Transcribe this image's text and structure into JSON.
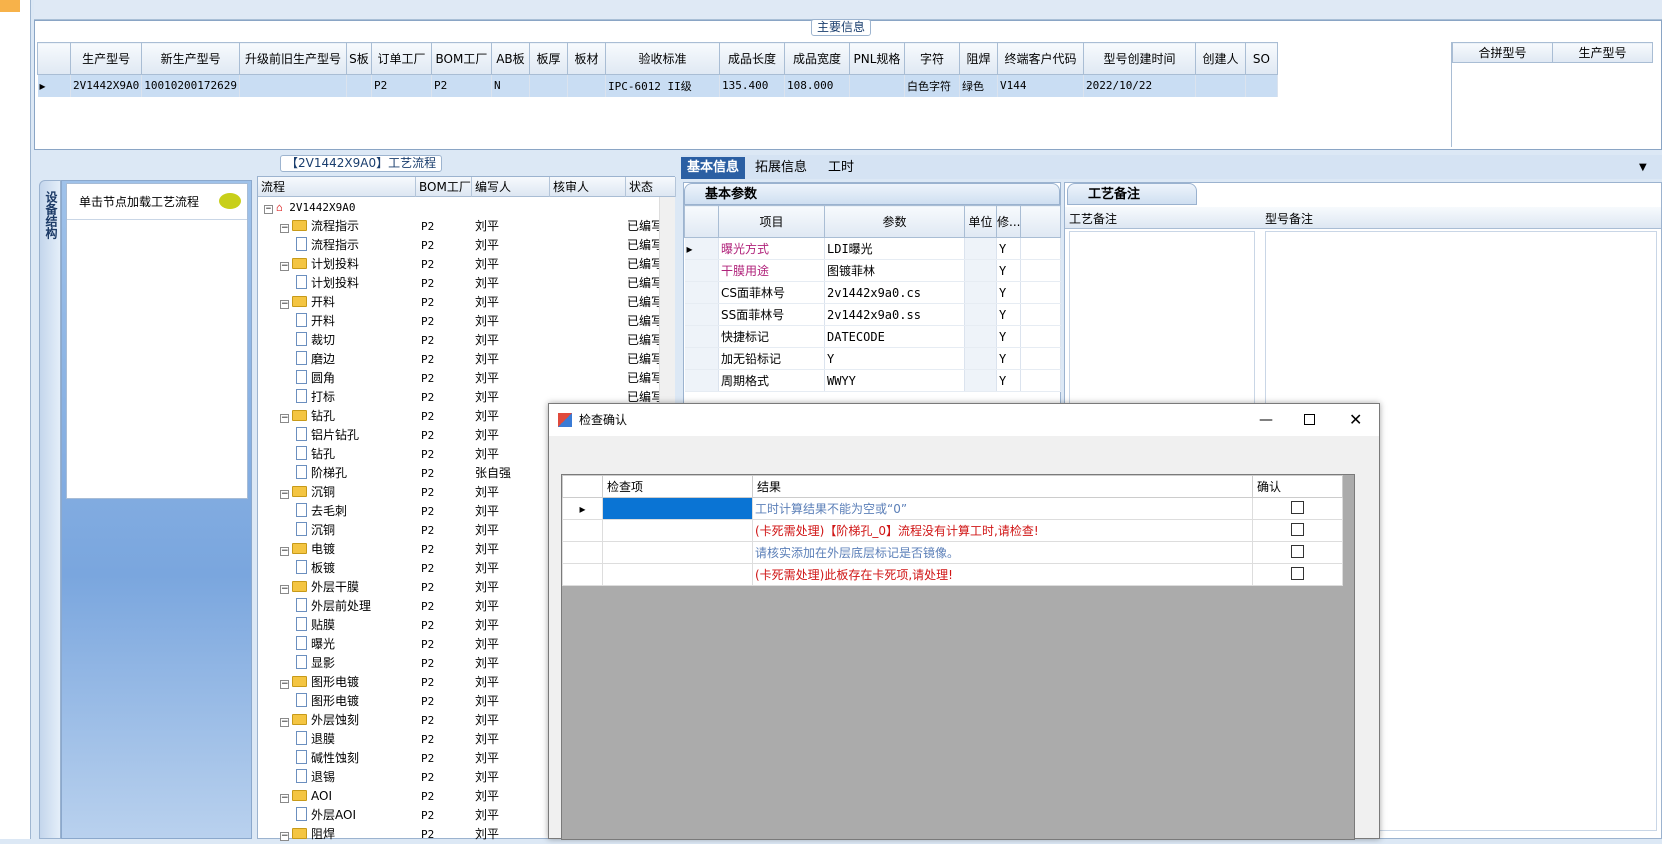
{
  "main_info": {
    "title": "主要信息",
    "columns": [
      "生产型号",
      "新生产型号",
      "升级前旧生产型号",
      "S板",
      "订单工厂",
      "BOM工厂",
      "AB板",
      "板厚",
      "板材",
      "验收标准",
      "成品长度",
      "成品宽度",
      "PNL规格",
      "字符",
      "阻焊",
      "终端客户代码",
      "型号创建时间",
      "创建人",
      "SO"
    ],
    "row": [
      "2V1442X9A0",
      "10010200172629",
      "",
      "",
      "P2",
      "P2",
      "N",
      "",
      "",
      "IPC-6012 II级",
      "135.400",
      "108.000",
      "",
      "白色字符",
      "绿色",
      "V144",
      "2022/10/22",
      "",
      ""
    ],
    "side_columns": [
      "合拼型号",
      "生产型号"
    ]
  },
  "flow": {
    "title": "【2V1442X9A0】工艺流程",
    "side_tab": "设备结构",
    "load_hint": "单击节点加载工艺流程",
    "columns": [
      "流程",
      "BOM工厂",
      "编写人",
      "核审人",
      "状态"
    ],
    "root": "2V1442X9A0",
    "rows": [
      {
        "name": "流程指示",
        "bom": "P2",
        "writer": "刘平",
        "status": "已编写",
        "level": 1,
        "folder": true
      },
      {
        "name": "流程指示",
        "bom": "P2",
        "writer": "刘平",
        "status": "已编写",
        "level": 2,
        "folder": false
      },
      {
        "name": "计划投料",
        "bom": "P2",
        "writer": "刘平",
        "status": "已编写",
        "level": 1,
        "folder": true
      },
      {
        "name": "计划投料",
        "bom": "P2",
        "writer": "刘平",
        "status": "已编写",
        "level": 2,
        "folder": false
      },
      {
        "name": "开料",
        "bom": "P2",
        "writer": "刘平",
        "status": "已编写",
        "level": 1,
        "folder": true
      },
      {
        "name": "开料",
        "bom": "P2",
        "writer": "刘平",
        "status": "已编写",
        "level": 2,
        "folder": false
      },
      {
        "name": "裁切",
        "bom": "P2",
        "writer": "刘平",
        "status": "已编写",
        "level": 2,
        "folder": false
      },
      {
        "name": "磨边",
        "bom": "P2",
        "writer": "刘平",
        "status": "已编写",
        "level": 2,
        "folder": false
      },
      {
        "name": "圆角",
        "bom": "P2",
        "writer": "刘平",
        "status": "已编写",
        "level": 2,
        "folder": false
      },
      {
        "name": "打标",
        "bom": "P2",
        "writer": "刘平",
        "status": "已编写",
        "level": 2,
        "folder": false
      },
      {
        "name": "钻孔",
        "bom": "P2",
        "writer": "刘平",
        "status": "",
        "level": 1,
        "folder": true
      },
      {
        "name": "铝片钻孔",
        "bom": "P2",
        "writer": "刘平",
        "status": "",
        "level": 2,
        "folder": false
      },
      {
        "name": "钻孔",
        "bom": "P2",
        "writer": "刘平",
        "status": "",
        "level": 2,
        "folder": false
      },
      {
        "name": "阶梯孔",
        "bom": "P2",
        "writer": "张自强",
        "status": "",
        "level": 2,
        "folder": false
      },
      {
        "name": "沉铜",
        "bom": "P2",
        "writer": "刘平",
        "status": "",
        "level": 1,
        "folder": true
      },
      {
        "name": "去毛刺",
        "bom": "P2",
        "writer": "刘平",
        "status": "",
        "level": 2,
        "folder": false
      },
      {
        "name": "沉铜",
        "bom": "P2",
        "writer": "刘平",
        "status": "",
        "level": 2,
        "folder": false
      },
      {
        "name": "电镀",
        "bom": "P2",
        "writer": "刘平",
        "status": "",
        "level": 1,
        "folder": true
      },
      {
        "name": "板镀",
        "bom": "P2",
        "writer": "刘平",
        "status": "",
        "level": 2,
        "folder": false
      },
      {
        "name": "外层干膜",
        "bom": "P2",
        "writer": "刘平",
        "status": "",
        "level": 1,
        "folder": true
      },
      {
        "name": "外层前处理",
        "bom": "P2",
        "writer": "刘平",
        "status": "",
        "level": 2,
        "folder": false
      },
      {
        "name": "贴膜",
        "bom": "P2",
        "writer": "刘平",
        "status": "",
        "level": 2,
        "folder": false
      },
      {
        "name": "曝光",
        "bom": "P2",
        "writer": "刘平",
        "status": "",
        "level": 2,
        "folder": false
      },
      {
        "name": "显影",
        "bom": "P2",
        "writer": "刘平",
        "status": "",
        "level": 2,
        "folder": false
      },
      {
        "name": "图形电镀",
        "bom": "P2",
        "writer": "刘平",
        "status": "",
        "level": 1,
        "folder": true
      },
      {
        "name": "图形电镀",
        "bom": "P2",
        "writer": "刘平",
        "status": "",
        "level": 2,
        "folder": false
      },
      {
        "name": "外层蚀刻",
        "bom": "P2",
        "writer": "刘平",
        "status": "",
        "level": 1,
        "folder": true
      },
      {
        "name": "退膜",
        "bom": "P2",
        "writer": "刘平",
        "status": "",
        "level": 2,
        "folder": false
      },
      {
        "name": "碱性蚀刻",
        "bom": "P2",
        "writer": "刘平",
        "status": "",
        "level": 2,
        "folder": false
      },
      {
        "name": "退锡",
        "bom": "P2",
        "writer": "刘平",
        "status": "",
        "level": 2,
        "folder": false
      },
      {
        "name": "AOI",
        "bom": "P2",
        "writer": "刘平",
        "status": "",
        "level": 1,
        "folder": true
      },
      {
        "name": "外层AOI",
        "bom": "P2",
        "writer": "刘平",
        "status": "",
        "level": 2,
        "folder": false
      },
      {
        "name": "阻焊",
        "bom": "P2",
        "writer": "刘平",
        "status": "",
        "level": 1,
        "folder": true
      }
    ]
  },
  "tabs": [
    "基本信息",
    "拓展信息",
    "工时"
  ],
  "params": {
    "title": "基本参数",
    "columns": [
      "项目",
      "参数",
      "单位",
      "修..."
    ],
    "rows": [
      {
        "item": "曝光方式",
        "value": "LDI曝光",
        "unit": "",
        "mod": "Y",
        "hl": true
      },
      {
        "item": "干膜用途",
        "value": "图镀菲林",
        "unit": "",
        "mod": "Y",
        "hl": true
      },
      {
        "item": "CS面菲林号",
        "value": "2v1442x9a0.cs",
        "unit": "",
        "mod": "Y",
        "hl": false
      },
      {
        "item": "SS面菲林号",
        "value": "2v1442x9a0.ss",
        "unit": "",
        "mod": "Y",
        "hl": false
      },
      {
        "item": "快捷标记",
        "value": "DATECODE",
        "unit": "",
        "mod": "Y",
        "hl": false
      },
      {
        "item": "加无铅标记",
        "value": "Y",
        "unit": "",
        "mod": "Y",
        "hl": false
      },
      {
        "item": "周期格式",
        "value": "WWYY",
        "unit": "",
        "mod": "Y",
        "hl": false
      }
    ]
  },
  "remarks": {
    "title": "工艺备注",
    "col1": "工艺备注",
    "col2": "型号备注"
  },
  "dialog": {
    "title": "检查确认",
    "columns": [
      "检查项",
      "结果",
      "确认"
    ],
    "rows": [
      {
        "item": "",
        "result": "工时计算结果不能为空或“0”",
        "color": "#5b7fb8"
      },
      {
        "item": "",
        "result": "(卡死需处理)【阶梯孔_0】流程没有计算工时,请检查!",
        "color": "#d01515"
      },
      {
        "item": "",
        "result": "请核实添加在外层底层标记是否镜像。",
        "color": "#5b7fb8"
      },
      {
        "item": "",
        "result": "(卡死需处理)此板存在卡死项,请处理!",
        "color": "#d01515"
      }
    ]
  }
}
